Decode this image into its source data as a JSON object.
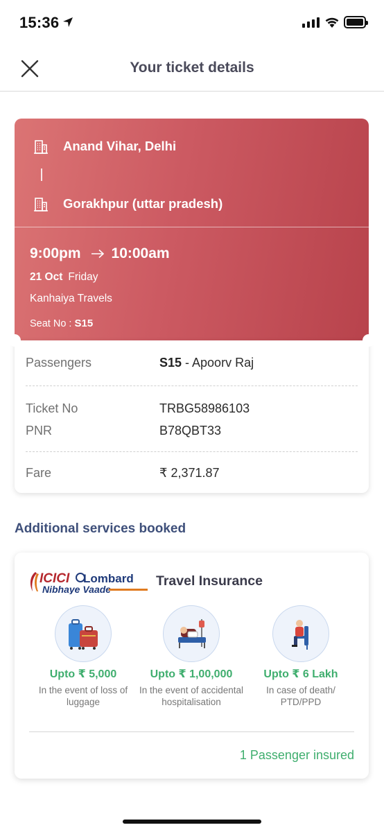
{
  "status_bar": {
    "time": "15:36"
  },
  "header": {
    "title": "Your ticket details"
  },
  "ticket": {
    "from": "Anand Vihar, Delhi",
    "route_separator": "|",
    "to": "Gorakhpur (uttar pradesh)",
    "departure": "9:00pm",
    "arrival": "10:00am",
    "date": "21 Oct",
    "day": "Friday",
    "operator": "Kanhaiya Travels",
    "seat_label": "Seat No : ",
    "seat": "S15",
    "passengers_label": "Passengers",
    "passenger_seat": "S15",
    "passenger_name": " - Apoorv Raj",
    "ticket_no_label": "Ticket No",
    "ticket_no": "TRBG58986103",
    "pnr_label": "PNR",
    "pnr": "B78QBT33",
    "fare_label": "Fare",
    "fare": "₹ 2,371.87"
  },
  "services": {
    "section_title": "Additional services booked",
    "logo_brand_left": "ICICI",
    "logo_brand_right": "Lombard",
    "logo_tagline": "Nibhaye Vaade",
    "title": "Travel Insurance",
    "benefits": [
      {
        "icon": "luggage-icon",
        "amount": "Upto ₹ 5,000",
        "desc": "In the event of loss of luggage"
      },
      {
        "icon": "hospital-bed-icon",
        "amount": "Upto ₹ 1,00,000",
        "desc": "In the event of accidental hospitalisation"
      },
      {
        "icon": "wheelchair-icon",
        "amount": "Upto ₹ 6 Lakh",
        "desc": "In case of death/ PTD/PPD"
      }
    ],
    "insured": "1 Passenger insured"
  },
  "colors": {
    "ticket_gradient_start": "#db7474",
    "ticket_gradient_end": "#b8434c",
    "section_title": "#3e4f7a",
    "benefit_green": "#3fae6e"
  }
}
